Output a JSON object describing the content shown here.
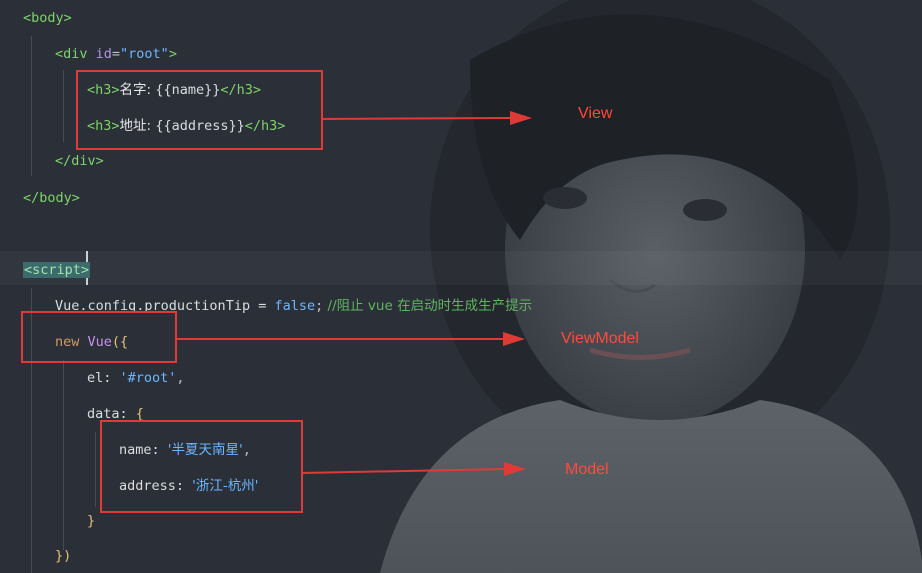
{
  "code_lines": {
    "body_open": "<body>",
    "div_open_a": "<div ",
    "div_attr": "id",
    "div_eq": "=",
    "div_val": "\"root\"",
    "div_open_b": ">",
    "h3_open": "<h3>",
    "h3_close": "</h3>",
    "name_label": "名字: ",
    "name_expr": "{{name}}",
    "address_label": "地址: ",
    "address_expr": "{{address}}",
    "div_close": "</div>",
    "body_close": "</body>",
    "script_open": "<script>",
    "config_obj": "Vue",
    "config_rest": ".config.productionTip = ",
    "config_false": "false",
    "config_semi": ";",
    "comment_start": " //阻止 vue 在启动时生成生产提示",
    "new_kw": "new ",
    "vue_cls": "Vue",
    "vue_paren": "({",
    "el_key": "el: ",
    "el_val": "'#root'",
    "el_comma": ",",
    "data_key": "data: ",
    "data_brace": "{",
    "name_key": "name: ",
    "name_val": "'半夏天南星'",
    "name_comma": ",",
    "address_key": "address: ",
    "address_val": "'浙江-杭州'",
    "data_close": "}",
    "vue_close": "})"
  },
  "annotations": {
    "view": "View",
    "viewmodel": "ViewModel",
    "model": "Model"
  },
  "colors": {
    "annotation_red": "#e03a36",
    "background": "#2b2f37"
  }
}
